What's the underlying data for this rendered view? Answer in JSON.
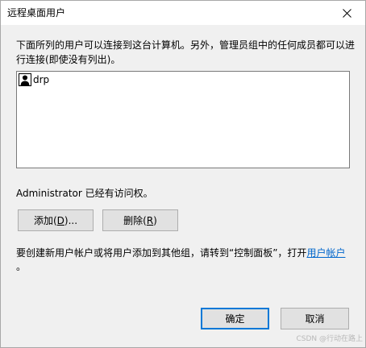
{
  "window": {
    "title": "远程桌面用户"
  },
  "description": "下面所列的用户可以连接到这台计算机。另外，管理员组中的任何成员都可以进行连接(即使没有列出)。",
  "user_list": {
    "items": [
      {
        "label": "drp",
        "icon": "user-icon"
      }
    ]
  },
  "access_text": "Administrator 已经有访问权。",
  "buttons": {
    "add_prefix": "添加(",
    "add_key": "D",
    "add_suffix": ")...",
    "remove_prefix": "删除(",
    "remove_key": "R",
    "remove_suffix": ")",
    "ok": "确定",
    "cancel": "取消"
  },
  "hint": {
    "text": "要创建新用户帐户或将用户添加到其他组，请转到“控制面板”，打开",
    "link": "用户帐户",
    "end": "。"
  },
  "watermark": "CSDN @行动在路上",
  "colors": {
    "link": "#0066cc",
    "default_button_border": "#0078d7"
  }
}
